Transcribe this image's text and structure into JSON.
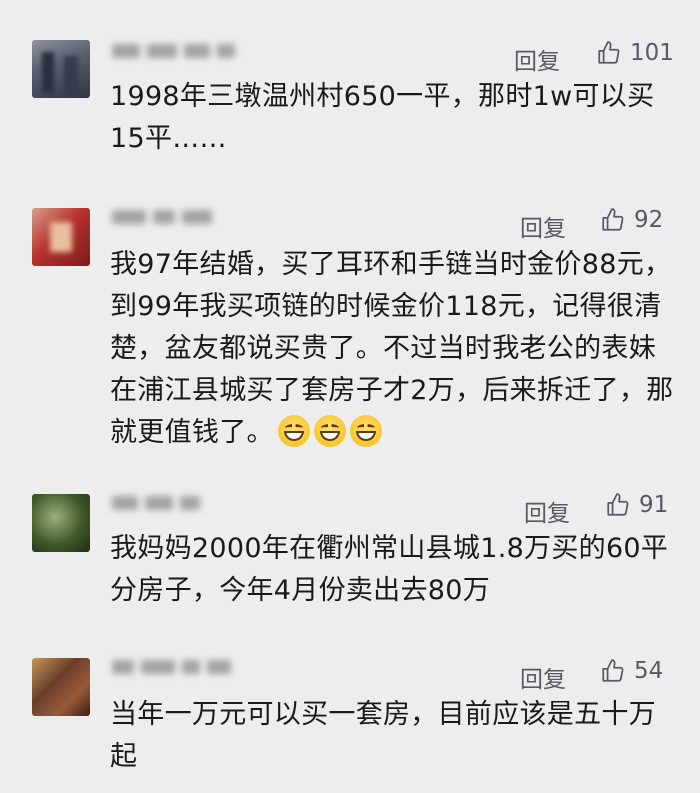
{
  "comments": [
    {
      "reply_label": "回复",
      "likes": "101",
      "text": "1998年三墩温州村650一平，那时1w可以买15平……",
      "avatar_colors": [
        "#3e4554",
        "#8d93a0"
      ]
    },
    {
      "reply_label": "回复",
      "likes": "92",
      "text": "我97年结婚，买了耳环和手链当时金价88元，到99年我买项链的时候金价118元，记得很清楚，盆友都说买贵了。不过当时我老公的表妹在浦江县城买了套房子才2万，后来拆迁了，那就更值钱了。",
      "emoji_count": 3,
      "avatar_colors": [
        "#b8322e",
        "#d9a08a"
      ]
    },
    {
      "reply_label": "回复",
      "likes": "91",
      "text": "我妈妈2000年在衢州常山县城1.8万买的60平分房子，今年4月份卖出去80万",
      "avatar_colors": [
        "#3f5a2a",
        "#9bb07a"
      ]
    },
    {
      "reply_label": "回复",
      "likes": "54",
      "text": "当年一万元可以买一套房，目前应该是五十万起",
      "avatar_colors": [
        "#6b3e2a",
        "#c49a5a"
      ]
    }
  ],
  "icons": {
    "like": "thumbs-up-icon"
  }
}
